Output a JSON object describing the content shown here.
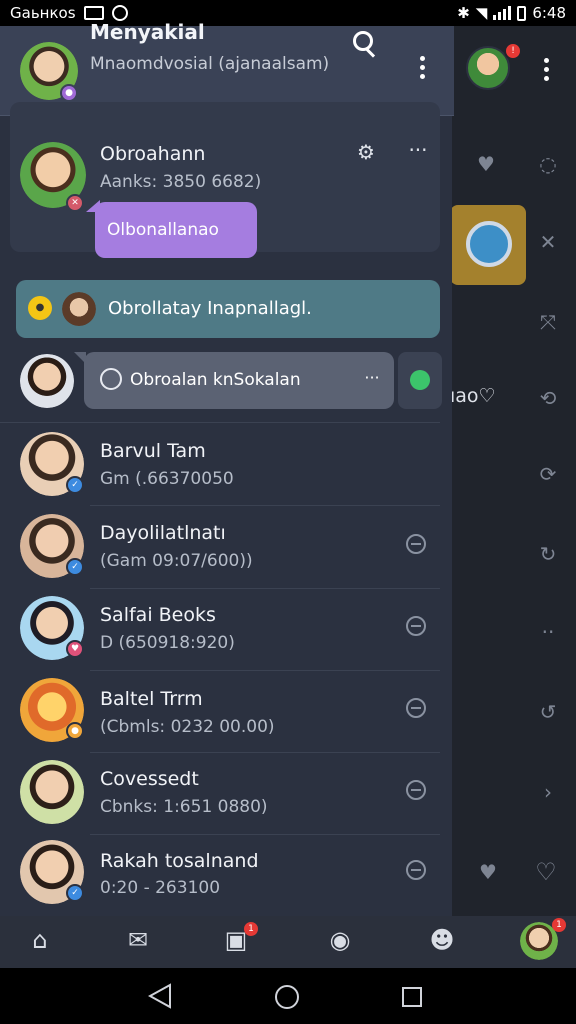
{
  "status_bar": {
    "carrier": "Gaьнкоs",
    "time": "6:48"
  },
  "header": {
    "name": "Menyakial",
    "subtitle": "Mnaomdvosial (ajanaalsam)"
  },
  "featured": {
    "name": "Obroahann",
    "subtitle": "Aanks: 3850 6682)",
    "bubble_text": "Olbonallanao"
  },
  "teal_row": {
    "text": "Obrollatay Inapnallagl."
  },
  "message": {
    "text": "Obroalan knSokalan"
  },
  "contacts": [
    {
      "name": "Barvul Tam",
      "subtitle": "Gm    (.66370050",
      "avatar_bg": "#e9cfb6"
    },
    {
      "name": "Dayolilatlnatı",
      "subtitle": "(Gam    09:07/600))",
      "avatar_bg": "#d8b59a"
    },
    {
      "name": "Salfai Beoks",
      "subtitle": "D    (650918:920)",
      "avatar_bg": "#a9d7f0"
    },
    {
      "name": "Baltel Trrm",
      "subtitle": "(Cbmls: 0232 00.00)",
      "avatar_bg": "#f0a63a"
    },
    {
      "name": "Covessedt",
      "subtitle": "Cbnks: 1:651 0880)",
      "avatar_bg": "#cfe0a6"
    },
    {
      "name": "Rakah tosalnand",
      "subtitle": "0:20 - 263100",
      "avatar_bg": "#e2c7ae"
    }
  ],
  "right_panel": {
    "text": "ıao♡"
  },
  "bottom_nav": {
    "items": [
      "home-icon",
      "chat-icon",
      "notifications-icon",
      "profile-icon",
      "contacts-icon",
      "account-avatar"
    ],
    "badge": "1"
  },
  "colors": {
    "drawer": "#2b3140",
    "header": "#3a4256",
    "bubble": "#a57de0",
    "teal": "#4f7a86",
    "accent_red": "#e53935"
  }
}
